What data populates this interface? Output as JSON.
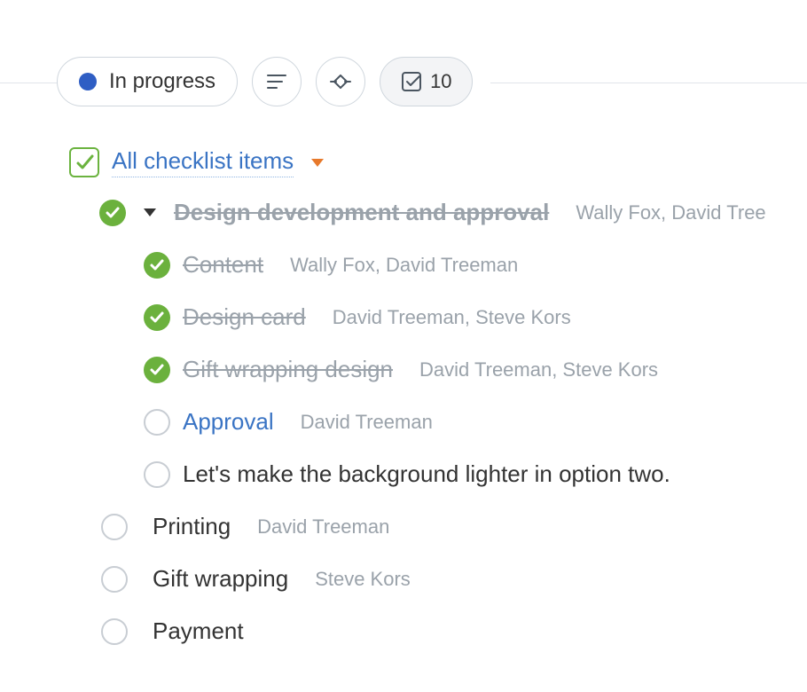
{
  "toolbar": {
    "status_label": "In progress",
    "checklist_count": "10"
  },
  "header": {
    "title": "All checklist items"
  },
  "items": {
    "parent": {
      "title": "Design development and approval",
      "assignees": "Wally Fox, David Tree"
    },
    "content": {
      "title": "Content",
      "assignees": "Wally Fox, David Treeman"
    },
    "design_card": {
      "title": "Design card",
      "assignees": "David Treeman, Steve Kors"
    },
    "gift_wrap_design": {
      "title": "Gift wrapping design",
      "assignees": "David Treeman, Steve Kors"
    },
    "approval": {
      "title": "Approval",
      "assignees": "David Treeman"
    },
    "background_note": {
      "title": "Let's make the background lighter in option two."
    },
    "printing": {
      "title": "Printing",
      "assignees": "David Treeman"
    },
    "gift_wrapping": {
      "title": "Gift wrapping",
      "assignees": "Steve Kors"
    },
    "payment": {
      "title": "Payment"
    }
  }
}
